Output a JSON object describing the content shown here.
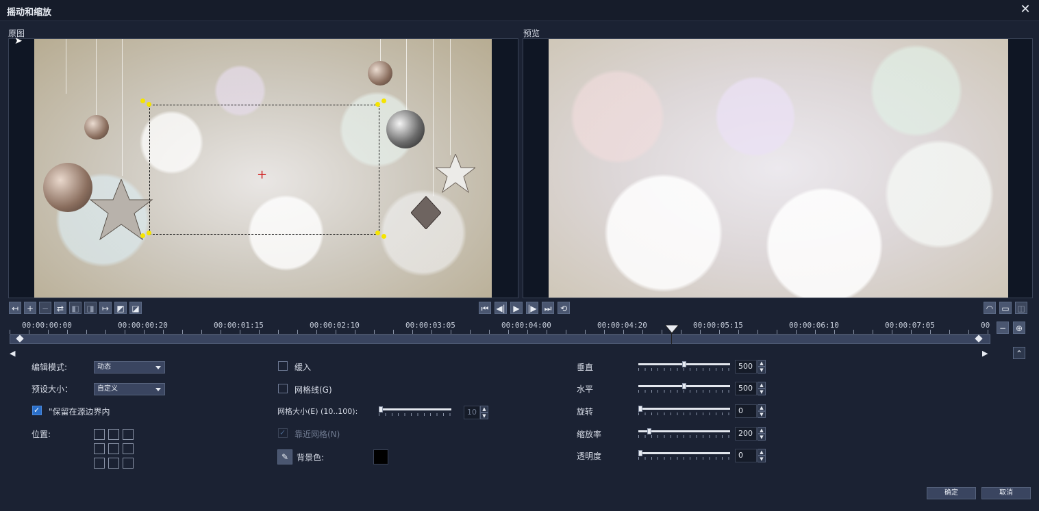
{
  "window": {
    "title": "摇动和缩放",
    "close_glyph": "✕"
  },
  "panels": {
    "original_label": "原图",
    "preview_label": "预览"
  },
  "playback": [
    "⏮",
    "◀|",
    "▶",
    "|▶",
    "⏭",
    "⟲"
  ],
  "timeline": {
    "ticks": [
      "00:00:00:00",
      "00:00:00:20",
      "00:00:01:15",
      "00:00:02:10",
      "00:00:03:05",
      "00:00:04:00",
      "00:00:04:20",
      "00:00:05:15",
      "00:00:06:10",
      "00:00:07:05",
      "00"
    ],
    "playhead_fraction": 0.676
  },
  "left_controls": {
    "edit_mode_label": "编辑模式:",
    "edit_mode_value": "动态",
    "preset_size_label": "预设大小：",
    "preset_size_value": "自定义",
    "keep_in_bounds_label": "\"保留在源边界内",
    "position_label": "位置:"
  },
  "middle_controls": {
    "ease_in_label": "缓入",
    "gridlines_label": "网格线(G)",
    "grid_size_label": "网格大小(E) (10..100):",
    "grid_size_value": "10",
    "snap_to_grid_label": "靠近网格(N)",
    "bg_color_label": "背景色:",
    "bg_color": "#000000"
  },
  "right_controls": {
    "sliders": [
      {
        "label": "垂直",
        "value": "500",
        "fraction": 0.5
      },
      {
        "label": "水平",
        "value": "500",
        "fraction": 0.5
      },
      {
        "label": "旋转",
        "value": "0",
        "fraction": 0.0
      },
      {
        "label": "缩放率",
        "value": "200",
        "fraction": 0.1
      },
      {
        "label": "透明度",
        "value": "0",
        "fraction": 0.0
      }
    ]
  },
  "buttons": {
    "ok": "确定",
    "cancel": "取消"
  },
  "colors": {
    "background": "#1b2233",
    "selection_handle": "#f5e400",
    "checkbox_checked": "#2a6fc9"
  }
}
